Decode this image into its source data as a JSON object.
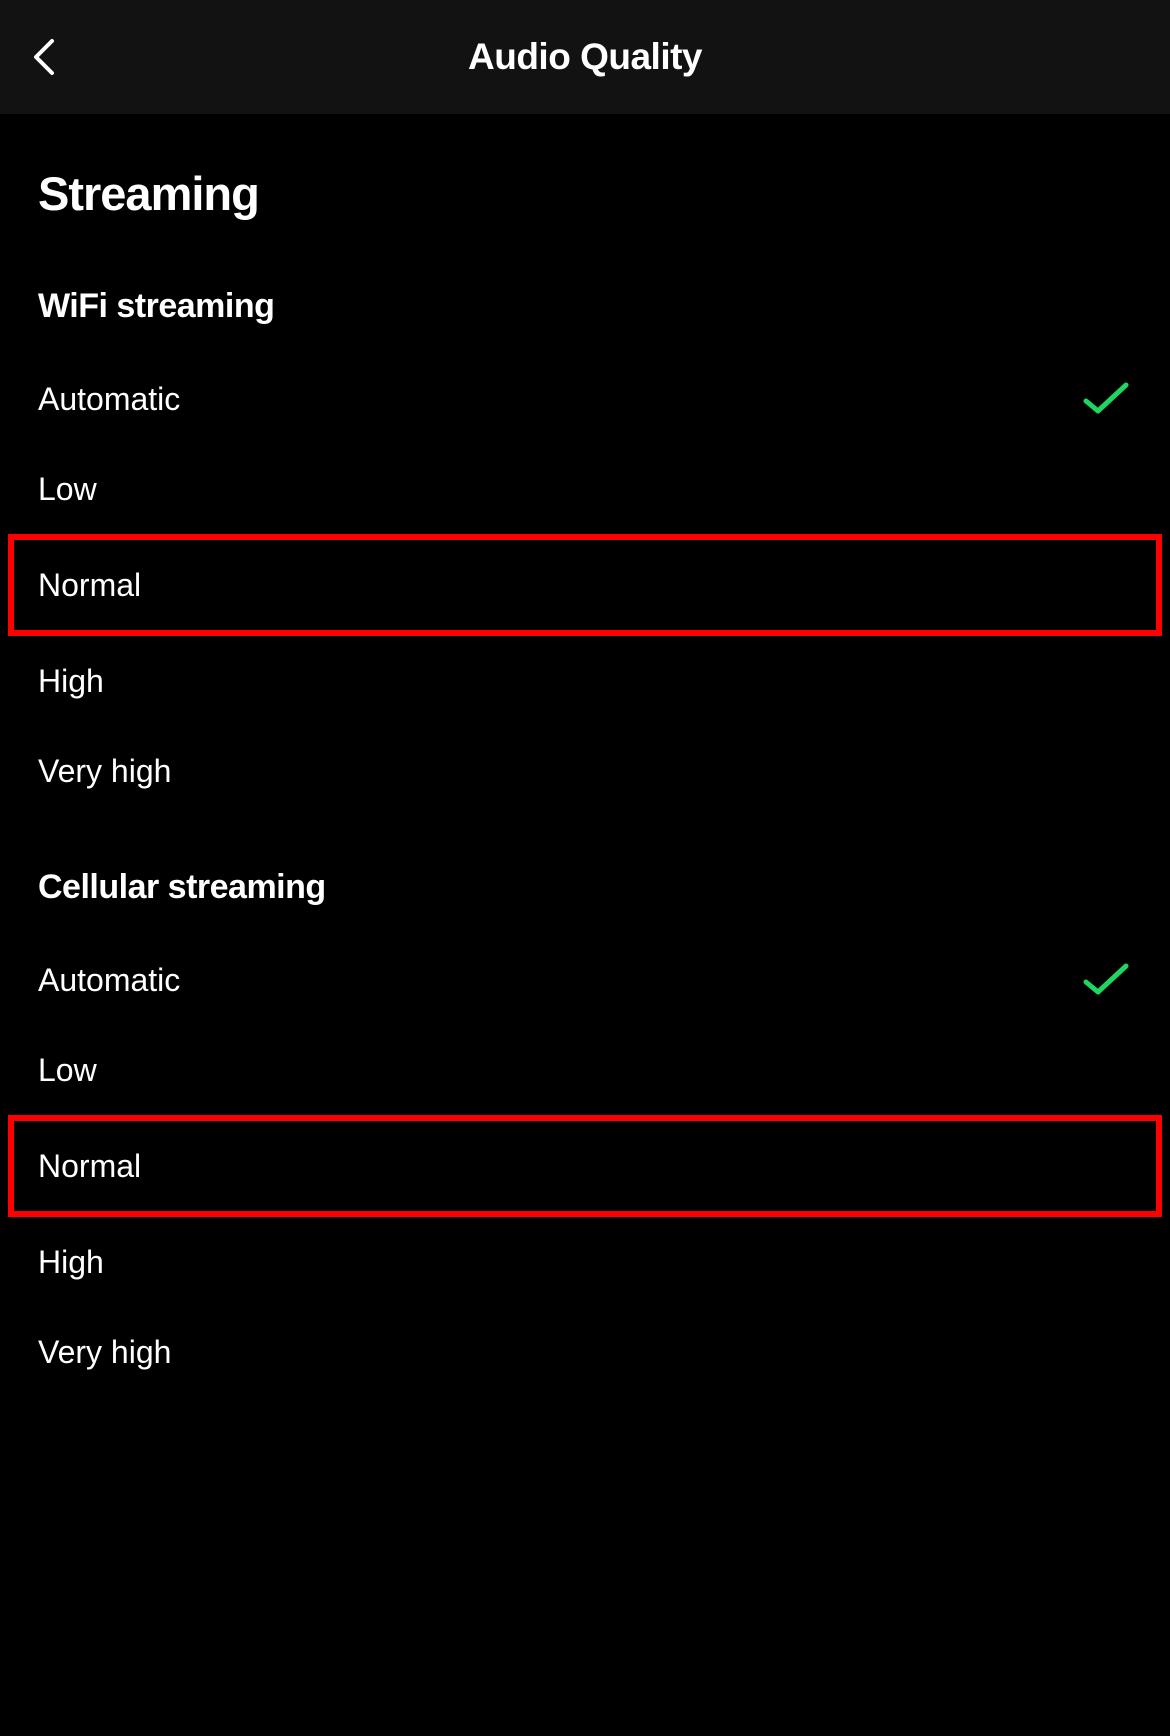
{
  "header": {
    "title": "Audio Quality"
  },
  "section": {
    "title": "Streaming"
  },
  "wifi": {
    "title": "WiFi streaming",
    "options": [
      {
        "label": "Automatic",
        "selected": true
      },
      {
        "label": "Low",
        "selected": false
      },
      {
        "label": "Normal",
        "selected": false
      },
      {
        "label": "High",
        "selected": false
      },
      {
        "label": "Very high",
        "selected": false
      }
    ]
  },
  "cellular": {
    "title": "Cellular streaming",
    "options": [
      {
        "label": "Automatic",
        "selected": true
      },
      {
        "label": "Low",
        "selected": false
      },
      {
        "label": "Normal",
        "selected": false
      },
      {
        "label": "High",
        "selected": false
      },
      {
        "label": "Very high",
        "selected": false
      }
    ]
  },
  "colors": {
    "accent": "#1ed760",
    "highlight": "#ff0000"
  }
}
